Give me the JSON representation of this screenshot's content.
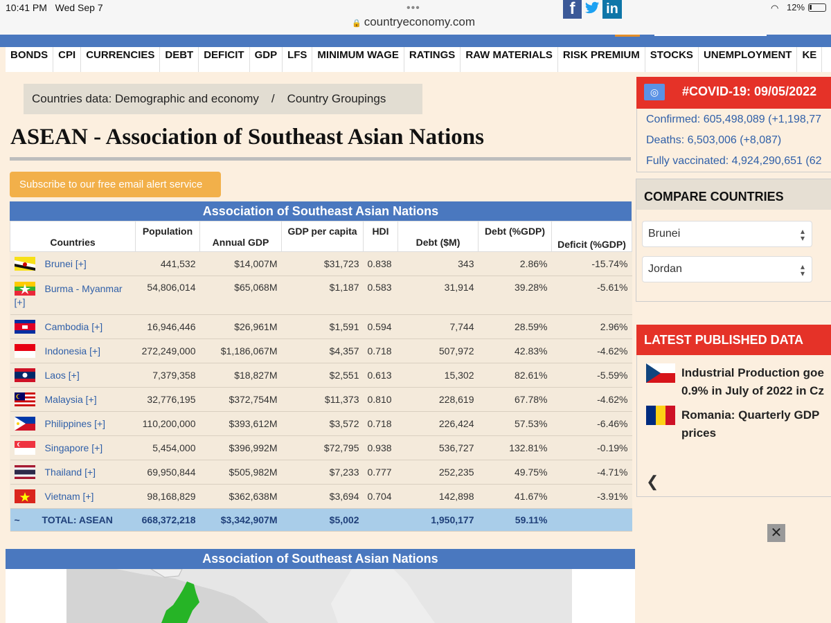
{
  "status": {
    "time": "10:41 PM",
    "date": "Wed Sep 7",
    "url": "countryeconomy.com",
    "battery": "12%"
  },
  "nav": [
    "BONDS",
    "CPI",
    "CURRENCIES",
    "DEBT",
    "DEFICIT",
    "GDP",
    "LFS",
    "MINIMUM WAGE",
    "RATINGS",
    "RAW MATERIALS",
    "RISK PREMIUM",
    "STOCKS",
    "UNEMPLOYMENT",
    "KE"
  ],
  "breadcrumb": {
    "item1": "Countries data: Demographic and economy",
    "sep": "/",
    "item2": "Country Groupings"
  },
  "page_title": "ASEAN - Association of Southeast Asian Nations",
  "subscribe": "Subscribe to our free email alert service",
  "social": {
    "facebook": "f",
    "twitter": "🐦",
    "linkedin": "in"
  },
  "table": {
    "caption": "Association of Southeast Asian Nations",
    "headers": {
      "countries": "Countries",
      "population": "Population",
      "annual_gdp": "Annual GDP",
      "gdp_per_capita": "GDP per capita",
      "hdi": "HDI",
      "debt_m": "Debt ($M)",
      "debt_gdp": "Debt (%GDP)",
      "deficit": "Deficit (%GDP)"
    },
    "rows": [
      {
        "country": "Brunei [+]",
        "population": "441,532",
        "gdp": "$14,007M",
        "gdp_pc": "$31,723",
        "hdi": "0.838",
        "debt": "343",
        "debt_pct": "2.86%",
        "deficit": "-15.74%"
      },
      {
        "country": "Burma - Myanmar [+]",
        "population": "54,806,014",
        "gdp": "$65,068M",
        "gdp_pc": "$1,187",
        "hdi": "0.583",
        "debt": "31,914",
        "debt_pct": "39.28%",
        "deficit": "-5.61%"
      },
      {
        "country": "Cambodia [+]",
        "population": "16,946,446",
        "gdp": "$26,961M",
        "gdp_pc": "$1,591",
        "hdi": "0.594",
        "debt": "7,744",
        "debt_pct": "28.59%",
        "deficit": "2.96%"
      },
      {
        "country": "Indonesia [+]",
        "population": "272,249,000",
        "gdp": "$1,186,067M",
        "gdp_pc": "$4,357",
        "hdi": "0.718",
        "debt": "507,972",
        "debt_pct": "42.83%",
        "deficit": "-4.62%"
      },
      {
        "country": "Laos [+]",
        "population": "7,379,358",
        "gdp": "$18,827M",
        "gdp_pc": "$2,551",
        "hdi": "0.613",
        "debt": "15,302",
        "debt_pct": "82.61%",
        "deficit": "-5.59%"
      },
      {
        "country": "Malaysia [+]",
        "population": "32,776,195",
        "gdp": "$372,754M",
        "gdp_pc": "$11,373",
        "hdi": "0.810",
        "debt": "228,619",
        "debt_pct": "67.78%",
        "deficit": "-4.62%"
      },
      {
        "country": "Philippines [+]",
        "population": "110,200,000",
        "gdp": "$393,612M",
        "gdp_pc": "$3,572",
        "hdi": "0.718",
        "debt": "226,424",
        "debt_pct": "57.53%",
        "deficit": "-6.46%"
      },
      {
        "country": "Singapore [+]",
        "population": "5,454,000",
        "gdp": "$396,992M",
        "gdp_pc": "$72,795",
        "hdi": "0.938",
        "debt": "536,727",
        "debt_pct": "132.81%",
        "deficit": "-0.19%"
      },
      {
        "country": "Thailand [+]",
        "population": "69,950,844",
        "gdp": "$505,982M",
        "gdp_pc": "$7,233",
        "hdi": "0.777",
        "debt": "252,235",
        "debt_pct": "49.75%",
        "deficit": "-4.71%"
      },
      {
        "country": "Vietnam [+]",
        "population": "98,168,829",
        "gdp": "$362,638M",
        "gdp_pc": "$3,694",
        "hdi": "0.704",
        "debt": "142,898",
        "debt_pct": "41.67%",
        "deficit": "-3.91%"
      }
    ],
    "total": {
      "marker": "~",
      "label": "TOTAL: ASEAN",
      "population": "668,372,218",
      "gdp": "$3,342,907M",
      "gdp_pc": "$5,002",
      "debt": "1,950,177",
      "debt_pct": "59.11%"
    }
  },
  "covid": {
    "title": "#COVID-19: 09/05/2022",
    "confirmed": "Confirmed: 605,498,089 (+1,198,77",
    "deaths": "Deaths: 6,503,006 (+8,087)",
    "vaccinated": "Fully vaccinated: 4,924,290,651 (62"
  },
  "compare": {
    "title": "COMPARE COUNTRIES",
    "country1": "Brunei",
    "country2": "Jordan"
  },
  "latest": {
    "title": "LATEST PUBLISHED DATA",
    "item1_line1": "Industrial Production goe",
    "item1_line2": "0.9% in July of 2022 in Cz",
    "item2_line1": "Romania: Quarterly GDP",
    "item2_line2": "prices"
  },
  "close": "✕",
  "map_caption": "Association of Southeast Asian Nations",
  "colors": {
    "header_blue": "#4a78bf",
    "red": "#e53228",
    "orange": "#f2b04a",
    "background": "#fcefdf",
    "total_row": "#a9cde9",
    "link": "#2f5fa8"
  }
}
